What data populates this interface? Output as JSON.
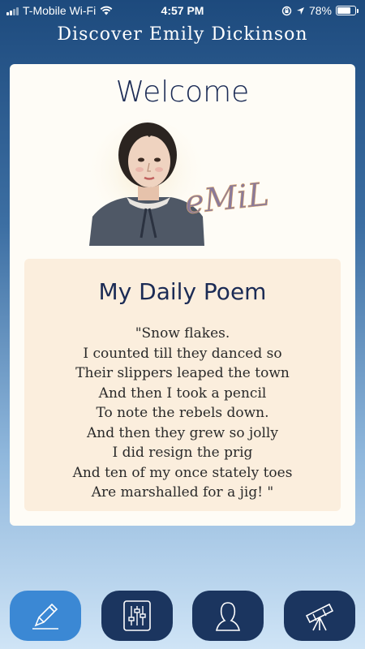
{
  "status": {
    "carrier": "T-Mobile Wi-Fi",
    "time": "4:57 PM",
    "battery": "78%",
    "battery_level": 0.78
  },
  "header": {
    "title": "Discover Emily Dickinson"
  },
  "card": {
    "welcome": "Welcome",
    "signature_text": "eMiLy",
    "poem": {
      "title": "My Daily Poem",
      "lines": [
        "\"Snow flakes.",
        "I counted till they danced so",
        "Their slippers leaped the town",
        "And then I took a pencil",
        "To note the rebels down.",
        "And then they grew so jolly",
        "I did resign the prig",
        "And ten of my once stately toes",
        "Are marshalled for a jig! \""
      ]
    }
  },
  "tabs": [
    {
      "icon": "pencil-icon",
      "active": true
    },
    {
      "icon": "sliders-icon",
      "active": false
    },
    {
      "icon": "person-icon",
      "active": false
    },
    {
      "icon": "telescope-icon",
      "active": false
    }
  ],
  "colors": {
    "tab_active": "#3b88d4",
    "tab_inactive": "#1b355f",
    "title_ink": "#1b2b55",
    "poem_bg": "#fbeedd"
  }
}
